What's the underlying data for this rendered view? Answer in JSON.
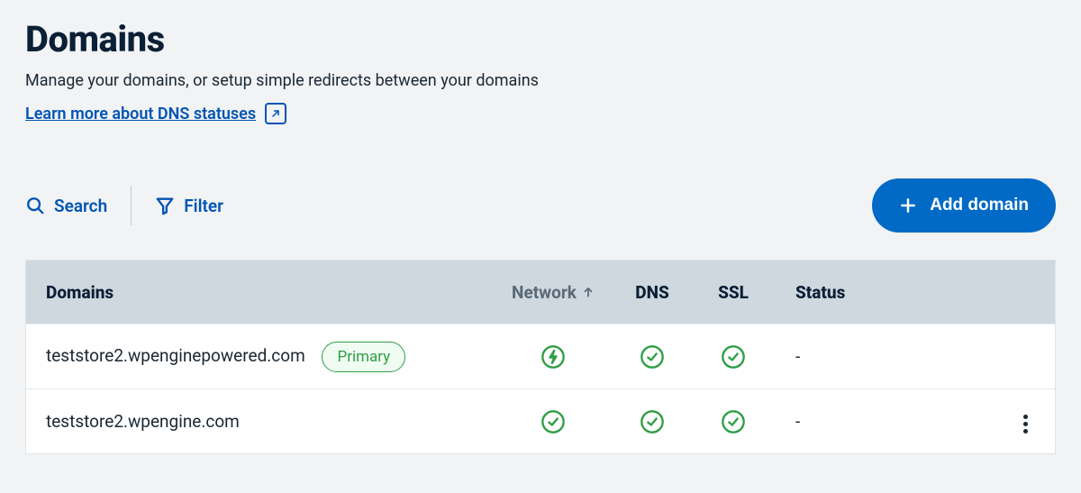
{
  "header": {
    "title": "Domains",
    "subtitle": "Manage your domains, or setup simple redirects between your domains",
    "learn_more": "Learn more about DNS statuses"
  },
  "toolbar": {
    "search_label": "Search",
    "filter_label": "Filter",
    "add_button": "Add domain"
  },
  "table": {
    "columns": {
      "domains": "Domains",
      "network": "Network",
      "dns": "DNS",
      "ssl": "SSL",
      "status": "Status"
    },
    "rows": [
      {
        "domain": "teststore2.wpenginepowered.com",
        "badge": "Primary",
        "network_icon": "bolt",
        "dns_ok": true,
        "ssl_ok": true,
        "status": "-",
        "has_actions": false
      },
      {
        "domain": "teststore2.wpengine.com",
        "badge": null,
        "network_icon": "check",
        "dns_ok": true,
        "ssl_ok": true,
        "status": "-",
        "has_actions": true
      }
    ]
  }
}
